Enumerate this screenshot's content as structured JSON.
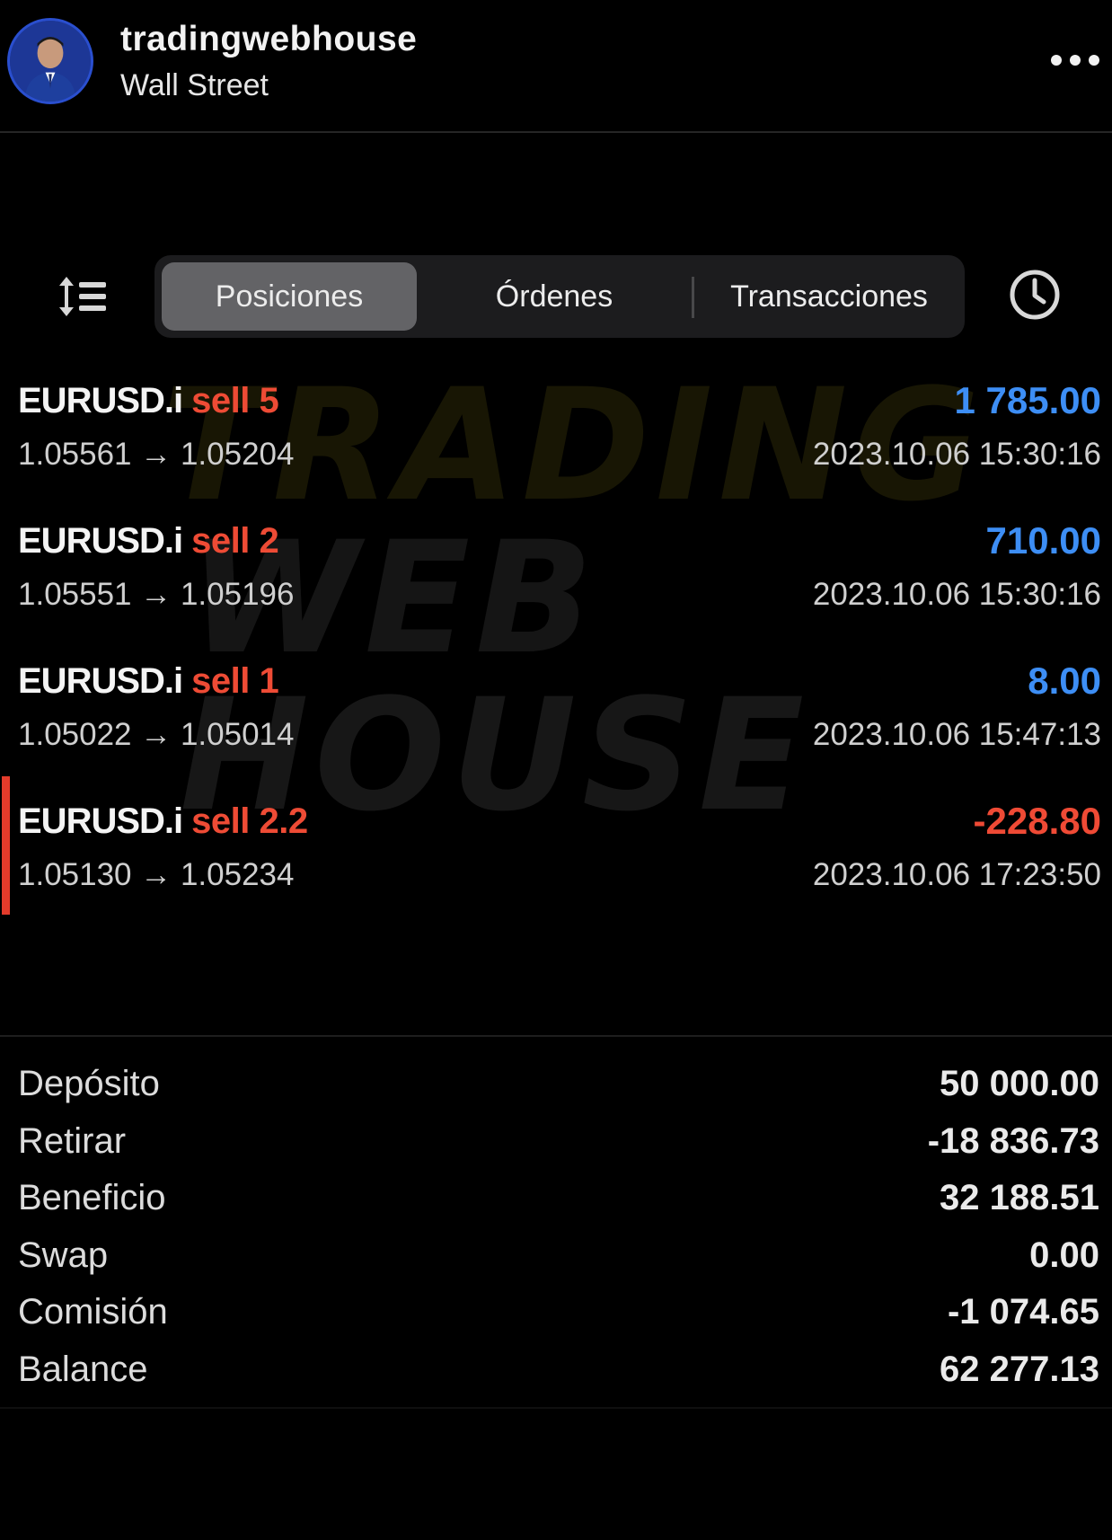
{
  "header": {
    "account_name": "tradingwebhouse",
    "location": "Wall Street",
    "avatar_icon": "profile-avatar",
    "more_icon": "more-dots-icon"
  },
  "toolbar": {
    "sort_icon": "sort-list-icon",
    "history_icon": "clock-icon",
    "tabs": [
      {
        "label": "Posiciones",
        "active": true
      },
      {
        "label": "Órdenes",
        "active": false
      },
      {
        "label": "Transacciones",
        "active": false
      }
    ]
  },
  "watermark": {
    "line1": "TRADING",
    "line2": "WEB",
    "line3": "HOUSE"
  },
  "positions": [
    {
      "symbol": "EURUSD.i",
      "side": "sell 5",
      "prices": "1.05561 → 1.05204",
      "profit": "1 785.00",
      "time": "2023.10.06 15:30:16"
    },
    {
      "symbol": "EURUSD.i",
      "side": "sell 2",
      "prices": "1.05551 → 1.05196",
      "profit": "710.00",
      "time": "2023.10.06 15:30:16"
    },
    {
      "symbol": "EURUSD.i",
      "side": "sell 1",
      "prices": "1.05022 → 1.05014",
      "profit": "8.00",
      "time": "2023.10.06 15:47:13"
    },
    {
      "symbol": "EURUSD.i",
      "side": "sell 2.2",
      "prices": "1.05130 → 1.05234",
      "profit": "-228.80",
      "time": "2023.10.06 17:23:50"
    }
  ],
  "summary": [
    {
      "label": "Depósito",
      "value": "50 000.00"
    },
    {
      "label": "Retirar",
      "value": "-18 836.73"
    },
    {
      "label": "Beneficio",
      "value": "32 188.51"
    },
    {
      "label": "Swap",
      "value": "0.00"
    },
    {
      "label": "Comisión",
      "value": "-1 074.65"
    },
    {
      "label": "Balance",
      "value": "62 277.13"
    }
  ],
  "colors": {
    "profit_positive": "#3d8ef5",
    "profit_negative": "#ef4a35",
    "sell": "#ee4b35",
    "background": "#000000"
  }
}
